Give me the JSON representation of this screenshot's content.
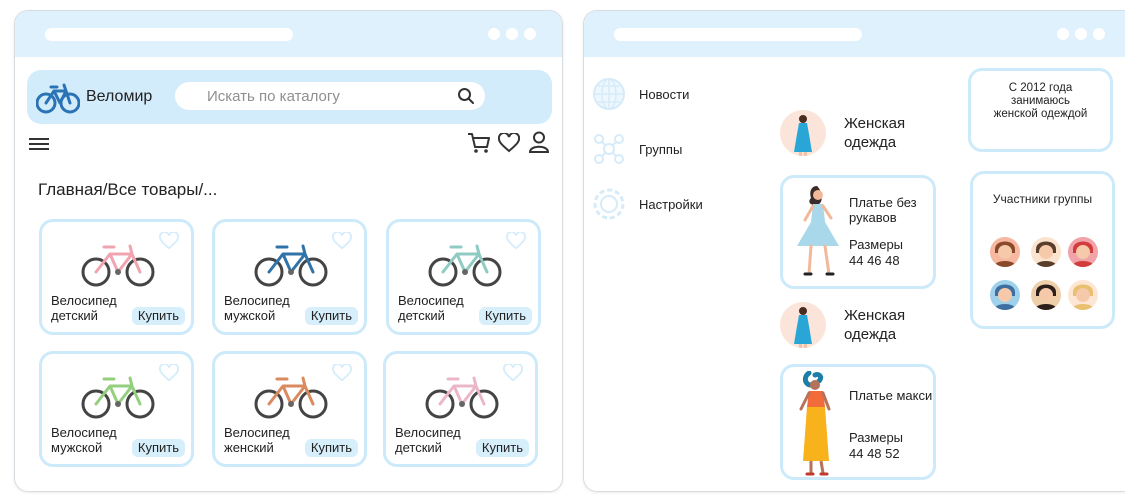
{
  "shop": {
    "brand": "Веломир",
    "search_placeholder": "Искать по каталогу",
    "breadcrumb": "Главная/Все товары/...",
    "products": [
      {
        "name": "Велосипед детский",
        "buy": "Купить",
        "color": "#f0a4b0"
      },
      {
        "name": "Велосипед мужской",
        "buy": "Купить",
        "color": "#2f73a8"
      },
      {
        "name": "Велосипед детский",
        "buy": "Купить",
        "color": "#8fcbc3"
      },
      {
        "name": "Велосипед мужской",
        "buy": "Купить",
        "color": "#93cf7e"
      },
      {
        "name": "Велосипед женский",
        "buy": "Купить",
        "color": "#d98a5e"
      },
      {
        "name": "Велосипед детский",
        "buy": "Купить",
        "color": "#eab7c8"
      }
    ]
  },
  "social": {
    "nav": [
      {
        "label": "Новости",
        "icon": "globe-icon"
      },
      {
        "label": "Группы",
        "icon": "group-icon"
      },
      {
        "label": "Настройки",
        "icon": "settings-icon"
      }
    ],
    "posts": [
      {
        "title": "Женская одежда",
        "item_name": "Платье без рукавов",
        "sizes_label": "Размеры",
        "sizes": "44 46 48"
      },
      {
        "title": "Женская одежда",
        "item_name": "Платье макси",
        "sizes_label": "Размеры",
        "sizes": "44 48 52"
      }
    ],
    "about": "С 2012 года занимаюсь женской одеждой",
    "members_title": "Участники группы"
  },
  "colors": {
    "accent": "#dff1fc",
    "card_border": "#cdeafb",
    "button": "#d7eefb"
  }
}
